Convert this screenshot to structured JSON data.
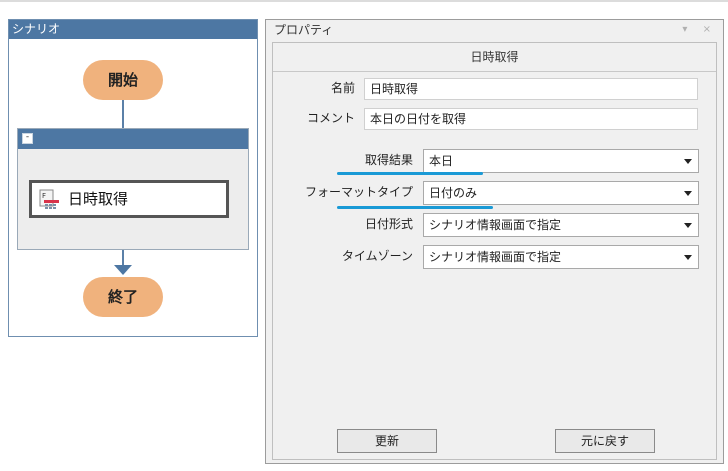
{
  "scenario": {
    "title": "シナリオ",
    "start_label": "開始",
    "end_label": "終了",
    "group_collapse_symbol": "-",
    "action_label": "日時取得",
    "action_icon": "datetime-action-icon"
  },
  "properties": {
    "window_title": "プロパティ",
    "window_buttons": "▾ ×",
    "header": "日時取得",
    "name_label": "名前",
    "name_value": "日時取得",
    "comment_label": "コメント",
    "comment_value": "本日の日付を取得",
    "result_label": "取得結果",
    "result_value": "本日",
    "format_type_label": "フォーマットタイプ",
    "format_type_value": "日付のみ",
    "date_format_label": "日付形式",
    "date_format_value": "シナリオ情報画面で指定",
    "timezone_label": "タイムゾーン",
    "timezone_value": "シナリオ情報画面で指定",
    "update_button": "更新",
    "revert_button": "元に戻す",
    "highlight_color": "#1a9ad6"
  }
}
